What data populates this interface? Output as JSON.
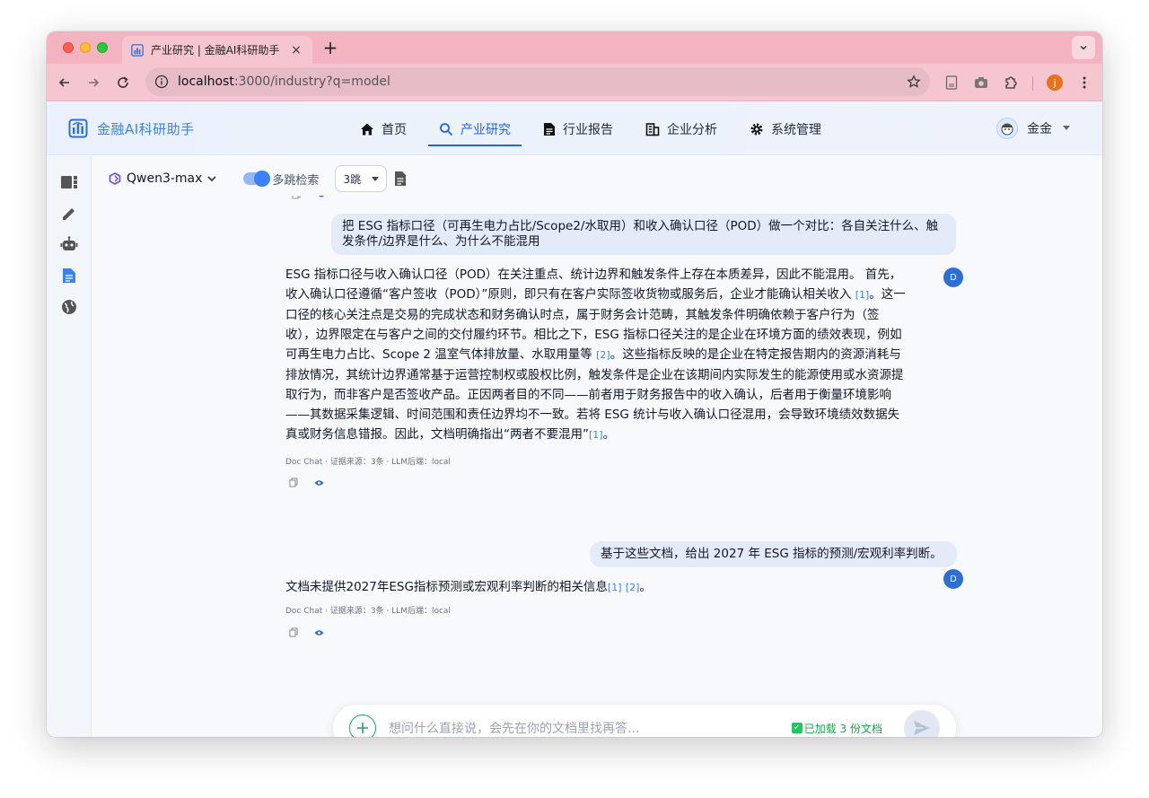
{
  "browser": {
    "tab_title": "产业研究 | 金融AI科研助手",
    "tab_close": "×",
    "new_tab": "+",
    "url_host": "localhost",
    "url_rest": ":3000/industry?q=model",
    "profile_initial": "j"
  },
  "app": {
    "brand": "金融AI科研助手",
    "nav": [
      {
        "label": "首页",
        "icon": "home-icon"
      },
      {
        "label": "产业研究",
        "icon": "search-icon",
        "active": true
      },
      {
        "label": "行业报告",
        "icon": "document-icon"
      },
      {
        "label": "企业分析",
        "icon": "building-icon"
      },
      {
        "label": "系统管理",
        "icon": "gear-icon"
      }
    ],
    "user_name": "金金"
  },
  "sidebar": {
    "icons": [
      "dashboard-icon",
      "edit-icon",
      "robot-icon",
      "document-icon",
      "globe-icon"
    ]
  },
  "controls": {
    "model": "Qwen3-max",
    "multi_hop_label": "多跳检索",
    "multi_hop_enabled": true,
    "hops": "3跳"
  },
  "chat": {
    "q1": "把 ESG 指标口径（可再生电力占比/Scope2/水取用）和收入确认口径（POD）做一个对比：各自关注什么、触发条件/边界是什么、为什么不能混用",
    "a1": {
      "p1": "ESG 指标口径与收入确认口径（POD）在关注重点、统计边界和触发条件上存在本质差异，因此不能混用。 首先，收入确认口径遵循“客户签收（POD）”原则，即只有在客户实际签收货物或服务后，企业才能确认相关收入",
      "c1": "[1]",
      "p2": "。这一口径的核心关注点是交易的完成状态和财务确认时点，属于财务会计范畴，其触发条件明确依赖于客户行为（签收），边界限定在与客户之间的交付履约环节。相比之下，ESG 指标口径关注的是企业在环境方面的绩效表现，例如可再生电力占比、Scope 2 温室气体排放量、水取用量等",
      "c2": "[2]",
      "p3": "。这些指标反映的是企业在特定报告期内的资源消耗与排放情况，其统计边界通常基于运营控制权或股权比例，触发条件是企业在该期间内实际发生的能源使用或水资源提取行为，而非客户是否签收产品。正因两者目的不同——前者用于财务报告中的收入确认，后者用于衡量环境影响——其数据采集逻辑、时间范围和责任边界均不一致。若将 ESG 统计与收入确认口径混用，会导致环境绩效数据失真或财务信息错报。因此，文档明确指出“两者不要混用”",
      "c3": "[1]",
      "p4": "。",
      "meta": "Doc Chat · 证据来源：3条 · LLM后端：local",
      "avatar": "D"
    },
    "q2": "基于这些文档，给出 2027 年 ESG 指标的预测/宏观利率判断。",
    "a2": {
      "p1": "文档未提供2027年ESG指标预测或宏观利率判断的相关信息",
      "c1": "[1]",
      "c2": "[2]",
      "p2": "。",
      "meta": "Doc Chat · 证据来源：3条 · LLM后端：local",
      "avatar": "D"
    }
  },
  "composer": {
    "placeholder": "想问什么直接说，会先在你的文档里找再答...",
    "loaded": "已加载 3 份文档"
  },
  "colors": {
    "tabstrip": "#f3b3c0",
    "accent": "#2563eb",
    "bot_avatar": "#2d6fd6"
  }
}
